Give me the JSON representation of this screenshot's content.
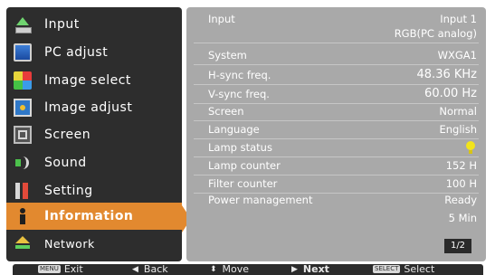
{
  "menu": {
    "items": [
      {
        "label": "Input",
        "icon": "input-icon"
      },
      {
        "label": "PC adjust",
        "icon": "monitor-icon"
      },
      {
        "label": "Image select",
        "icon": "image-select-icon"
      },
      {
        "label": "Image adjust",
        "icon": "image-adjust-icon"
      },
      {
        "label": "Screen",
        "icon": "screen-icon"
      },
      {
        "label": "Sound",
        "icon": "sound-icon"
      },
      {
        "label": "Setting",
        "icon": "setting-icon"
      },
      {
        "label": "Information",
        "icon": "information-icon",
        "active": true
      },
      {
        "label": "Network",
        "icon": "network-icon"
      }
    ]
  },
  "info": {
    "input_label": "Input",
    "input_value": "Input 1",
    "input_value2": "RGB(PC analog)",
    "system_label": "System",
    "system_value": "WXGA1",
    "hsync_label": "H-sync freq.",
    "hsync_value": "48.36 KHz",
    "vsync_label": "V-sync freq.",
    "vsync_value": "60.00  Hz",
    "screen_label": "Screen",
    "screen_value": "Normal",
    "language_label": "Language",
    "language_value": "English",
    "lamp_status_label": "Lamp status",
    "lamp_counter_label": "Lamp counter",
    "lamp_counter_value": "152 H",
    "filter_counter_label": "Filter counter",
    "filter_counter_value": "100 H",
    "power_mgmt_label": "Power management",
    "power_mgmt_value": "Ready",
    "power_mgmt_value2": "5 Min",
    "page": "1/2"
  },
  "bottom": {
    "exit_key": "MENU",
    "exit_label": "Exit",
    "back_label": "Back",
    "move_label": "Move",
    "next_label": "Next",
    "select_key": "SELECT",
    "select_label": "Select"
  },
  "colors": {
    "menu_bg": "#2d2d2d",
    "active": "#e2892f",
    "panel_bg": "#a9a9a9",
    "lamp": "#f2e41b"
  }
}
